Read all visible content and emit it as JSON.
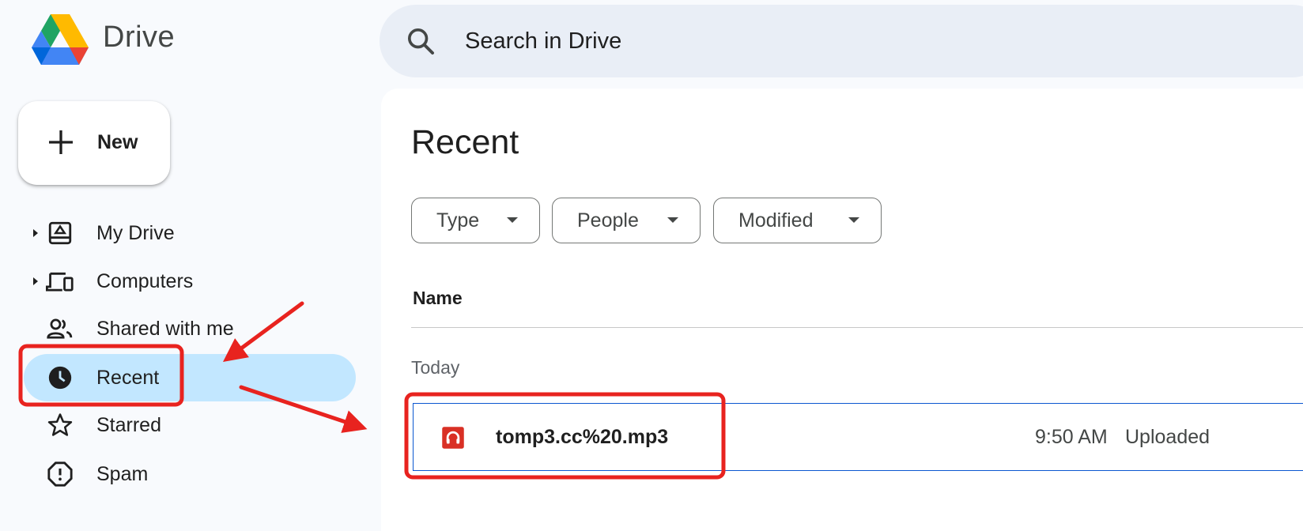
{
  "app": {
    "brand": "Drive"
  },
  "search": {
    "placeholder": "Search in Drive"
  },
  "sidebar": {
    "new_label": "New",
    "items": [
      {
        "label": "My Drive",
        "icon": "my-drive-icon"
      },
      {
        "label": "Computers",
        "icon": "computers-icon"
      },
      {
        "label": "Shared with me",
        "icon": "shared-icon"
      },
      {
        "label": "Recent",
        "icon": "clock-icon",
        "active": true
      },
      {
        "label": "Starred",
        "icon": "star-icon"
      },
      {
        "label": "Spam",
        "icon": "spam-icon"
      }
    ]
  },
  "main": {
    "title": "Recent",
    "filters": [
      "Type",
      "People",
      "Modified"
    ],
    "column_name": "Name",
    "group": "Today",
    "files": [
      {
        "name": "tomp3.cc%20.mp3",
        "time": "9:50 AM",
        "status": "Uploaded",
        "icon": "audio-file-icon"
      }
    ]
  },
  "colors": {
    "active_nav_bg": "#c2e7ff",
    "search_bg": "#e9eef6",
    "selection_border": "#0b57d0",
    "annotation_red": "#e8231f",
    "audio_icon": "#d93025"
  }
}
